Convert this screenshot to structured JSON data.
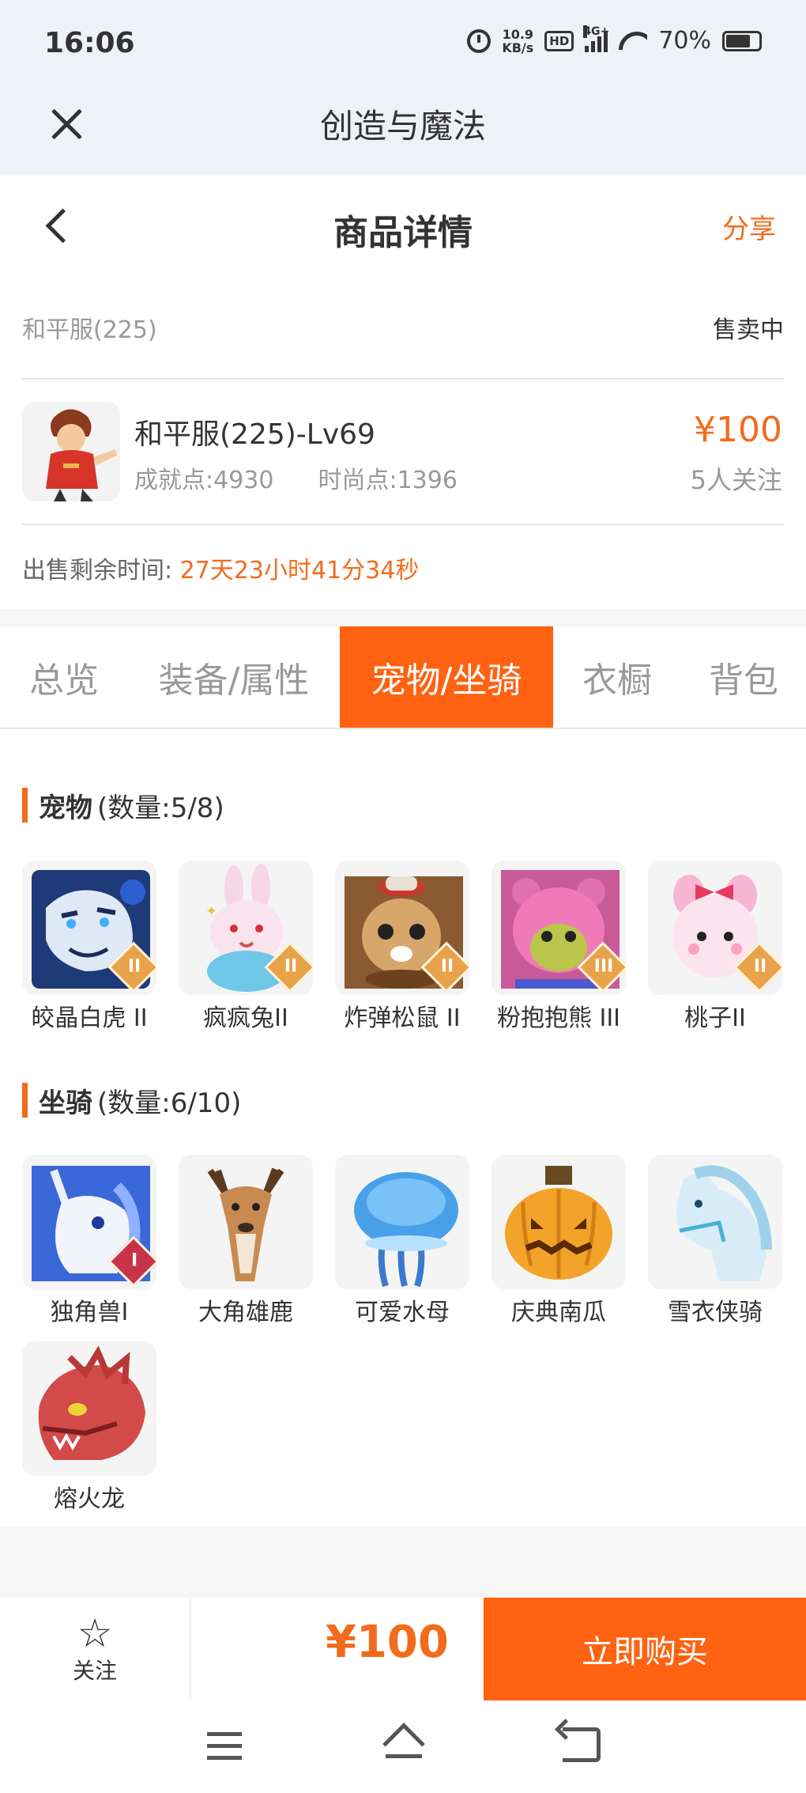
{
  "status_bar": {
    "time": "16:06",
    "net_speed_value": "10.9",
    "net_speed_unit": "KB/s",
    "hd_badge": "HD",
    "network_type": "4G+",
    "battery_percent": "70%"
  },
  "webview": {
    "title": "创造与魔法",
    "close_icon": "close-icon"
  },
  "header": {
    "title": "商品详情",
    "share_label": "分享",
    "back_icon": "back-icon"
  },
  "listing": {
    "server_name": "和平服(225)",
    "sale_status": "售卖中",
    "character_name": "和平服(225)-Lv69",
    "achievement_points": "成就点:4930",
    "fashion_points": "时尚点:1396",
    "price": "¥100",
    "followers": "5人关注",
    "remaining_label": "出售剩余时间:",
    "remaining_time": "27天23小时41分34秒"
  },
  "tabs": [
    {
      "label": "总览",
      "active": false
    },
    {
      "label": "装备/属性",
      "active": false
    },
    {
      "label": "宠物/坐骑",
      "active": true
    },
    {
      "label": "衣橱",
      "active": false
    },
    {
      "label": "背包",
      "active": false
    }
  ],
  "pets": {
    "title": "宠物",
    "count": "(数量:5/8)",
    "items": [
      {
        "name": "皎晶白虎 II",
        "grade": "II"
      },
      {
        "name": "疯疯兔II",
        "grade": "II"
      },
      {
        "name": "炸弹松鼠 II",
        "grade": "II"
      },
      {
        "name": "粉抱抱熊 III",
        "grade": "III"
      },
      {
        "name": "桃子II",
        "grade": "II"
      }
    ]
  },
  "mounts": {
    "title": "坐骑",
    "count": "(数量:6/10)",
    "items": [
      {
        "name": "独角兽I",
        "grade": "I"
      },
      {
        "name": "大角雄鹿"
      },
      {
        "name": "可爱水母"
      },
      {
        "name": "庆典南瓜"
      },
      {
        "name": "雪衣侠骑"
      },
      {
        "name": "熔火龙"
      }
    ]
  },
  "footer": {
    "follow_label": "关注",
    "price": "¥100",
    "buy_label": "立即购买"
  },
  "colors": {
    "accent": "#ff6211",
    "accent_text": "#f26b1d"
  }
}
